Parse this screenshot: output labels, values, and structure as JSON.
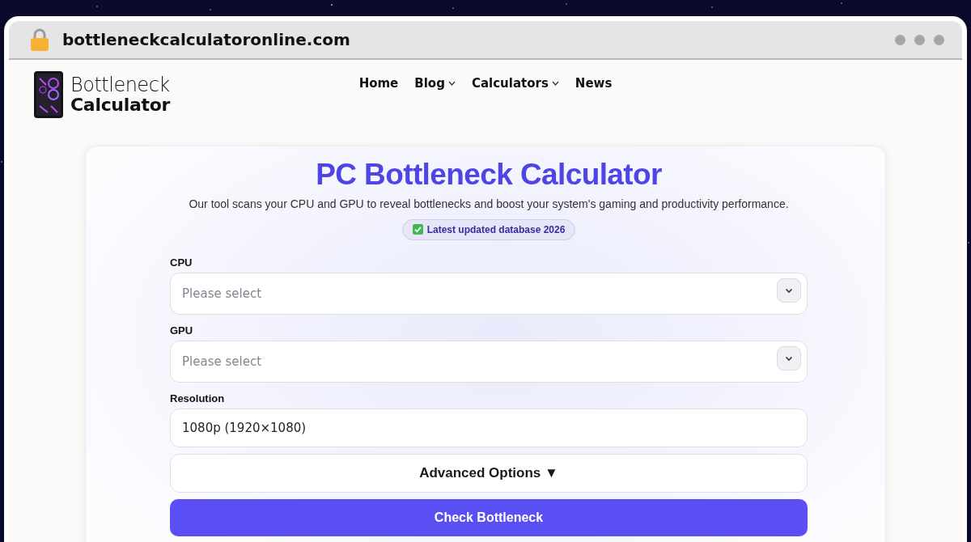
{
  "browser": {
    "url": "bottleneckcalculatoronline.com"
  },
  "header": {
    "logo": {
      "line_1": "Bottleneck",
      "line_2": "Calculator"
    },
    "nav": [
      {
        "label": "Home",
        "dropdown": false
      },
      {
        "label": "Blog",
        "dropdown": true
      },
      {
        "label": "Calculators",
        "dropdown": true
      },
      {
        "label": "News",
        "dropdown": false
      }
    ]
  },
  "card": {
    "title": "PC Bottleneck Calculator",
    "subtitle": "Our tool scans your CPU and GPU to reveal bottlenecks and boost your system's gaming and productivity performance.",
    "badge": "Latest updated database 2026",
    "fields": [
      {
        "kind": "select",
        "label": "CPU",
        "placeholder": "Please select"
      },
      {
        "kind": "select",
        "label": "GPU",
        "placeholder": "Please select"
      },
      {
        "kind": "text",
        "label": "Resolution",
        "value": "1080p (1920×1080)"
      }
    ],
    "advanced_toggle": "Advanced Options ▼",
    "submit": "Check Bottleneck"
  }
}
